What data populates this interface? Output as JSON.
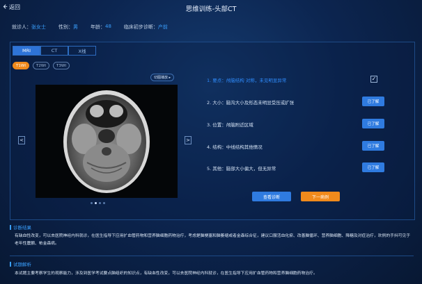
{
  "header": {
    "back_label": "返回",
    "title": "思维训练-头部CT"
  },
  "patient": {
    "name_label": "就诊人：",
    "name": "张女士",
    "gender_label": "性别：",
    "gender": "男",
    "age_label": "年龄：",
    "age": "48",
    "diagnosis_label": "临床初步诊断：",
    "diagnosis": "产前"
  },
  "tabs": [
    {
      "label": "MRI"
    },
    {
      "label": "CT"
    },
    {
      "label": "X线"
    }
  ],
  "subtabs": [
    {
      "label": "T1WI"
    },
    {
      "label": "T2WI"
    },
    {
      "label": "T3WI"
    }
  ],
  "viewer": {
    "play_label": "切图播放 ▸",
    "prev": "<",
    "next": ">",
    "slides": 4,
    "current_slide": 2
  },
  "questions": [
    {
      "text": "1. 要点：颅脑结构 对称，未见明显异常",
      "checked": true
    },
    {
      "text": "2. 大小：脑沟大小及形态未明显受压或扩张",
      "button": "已了解"
    },
    {
      "text": "3. 位置：颅脑附近区域",
      "button": "已了解"
    },
    {
      "text": "4. 结构：中线结构其他情况",
      "button": "已了解"
    },
    {
      "text": "5. 其他：脑部大小偏大，但无异常",
      "button": "已了解"
    }
  ],
  "actions": {
    "view_diagnosis": "查看诊断",
    "next_case": "下一病例"
  },
  "result": {
    "title": "诊断结果",
    "text": "有缺血性改变，可以去医院神经内科就诊，在医生指导下应用扩血管药物和营养脑细胞药物治疗，考虑是脑梗塞和脑萎缩或者金森综合征，建议口服活血化瘀、改善脑循环、营养脑细胞、降糖及对症治疗，欢例的手抖可见于老年性震颤、帕金森病。"
  },
  "analysis": {
    "title": "试题解析",
    "text": "本试题主要考察学生的观察能力，涉及到医学考试要点脑组织的知识点，有缺血性改变，可以去医院神经内科就诊，在医生指导下应用扩血管药物和营养脑细胞药物治疗。"
  },
  "colors": {
    "accent": "#2f7be0",
    "orange": "#f08a1c",
    "highlight": "#3aa0ff"
  }
}
